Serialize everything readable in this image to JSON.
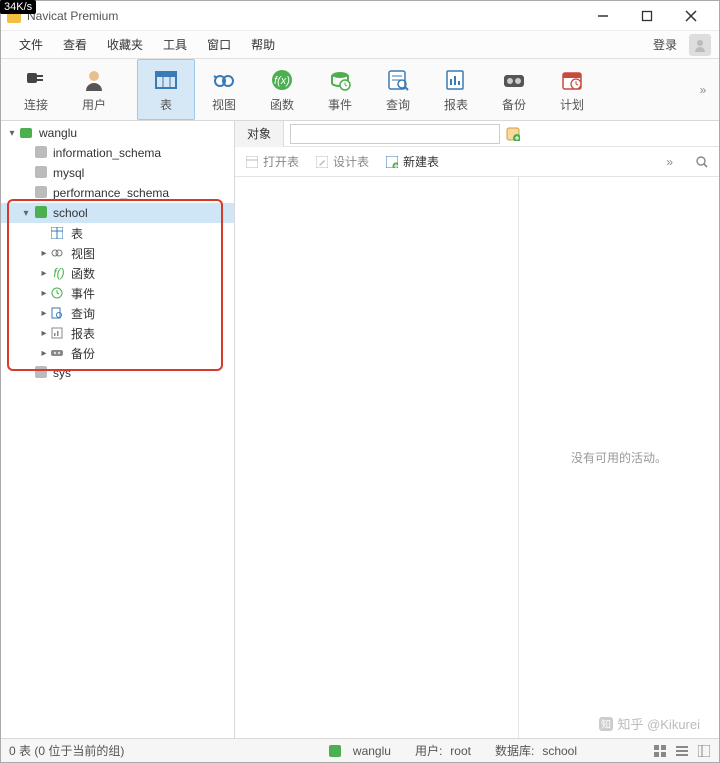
{
  "overlay": {
    "speed": "34K/s"
  },
  "titlebar": {
    "title": "Navicat Premium"
  },
  "menubar": {
    "file": "文件",
    "view": "查看",
    "fav": "收藏夹",
    "tools": "工具",
    "window": "窗口",
    "help": "帮助",
    "login": "登录"
  },
  "toolbar": {
    "connect": "连接",
    "user": "用户",
    "table": "表",
    "view": "视图",
    "function": "函数",
    "event": "事件",
    "query": "查询",
    "report": "报表",
    "backup": "备份",
    "schedule": "计划"
  },
  "tree": {
    "conn": "wanglu",
    "dbs": {
      "info": "information_schema",
      "mysql": "mysql",
      "perf": "performance_schema",
      "school": "school",
      "sys": "sys"
    },
    "school_children": {
      "tables": "表",
      "views": "视图",
      "funcs": "函数",
      "events": "事件",
      "queries": "查询",
      "reports": "报表",
      "backups": "备份"
    }
  },
  "right": {
    "tab": "对象",
    "open": "打开表",
    "design": "设计表",
    "new": "新建表",
    "chev": "»",
    "activity_empty": "没有可用的活动。"
  },
  "status": {
    "left": "0 表 (0 位于当前的组)",
    "conn": "wanglu",
    "user_label": "用户:",
    "user_value": "root",
    "db_label": "数据库:",
    "db_value": "school"
  },
  "watermark": "知乎 @Kikurei"
}
